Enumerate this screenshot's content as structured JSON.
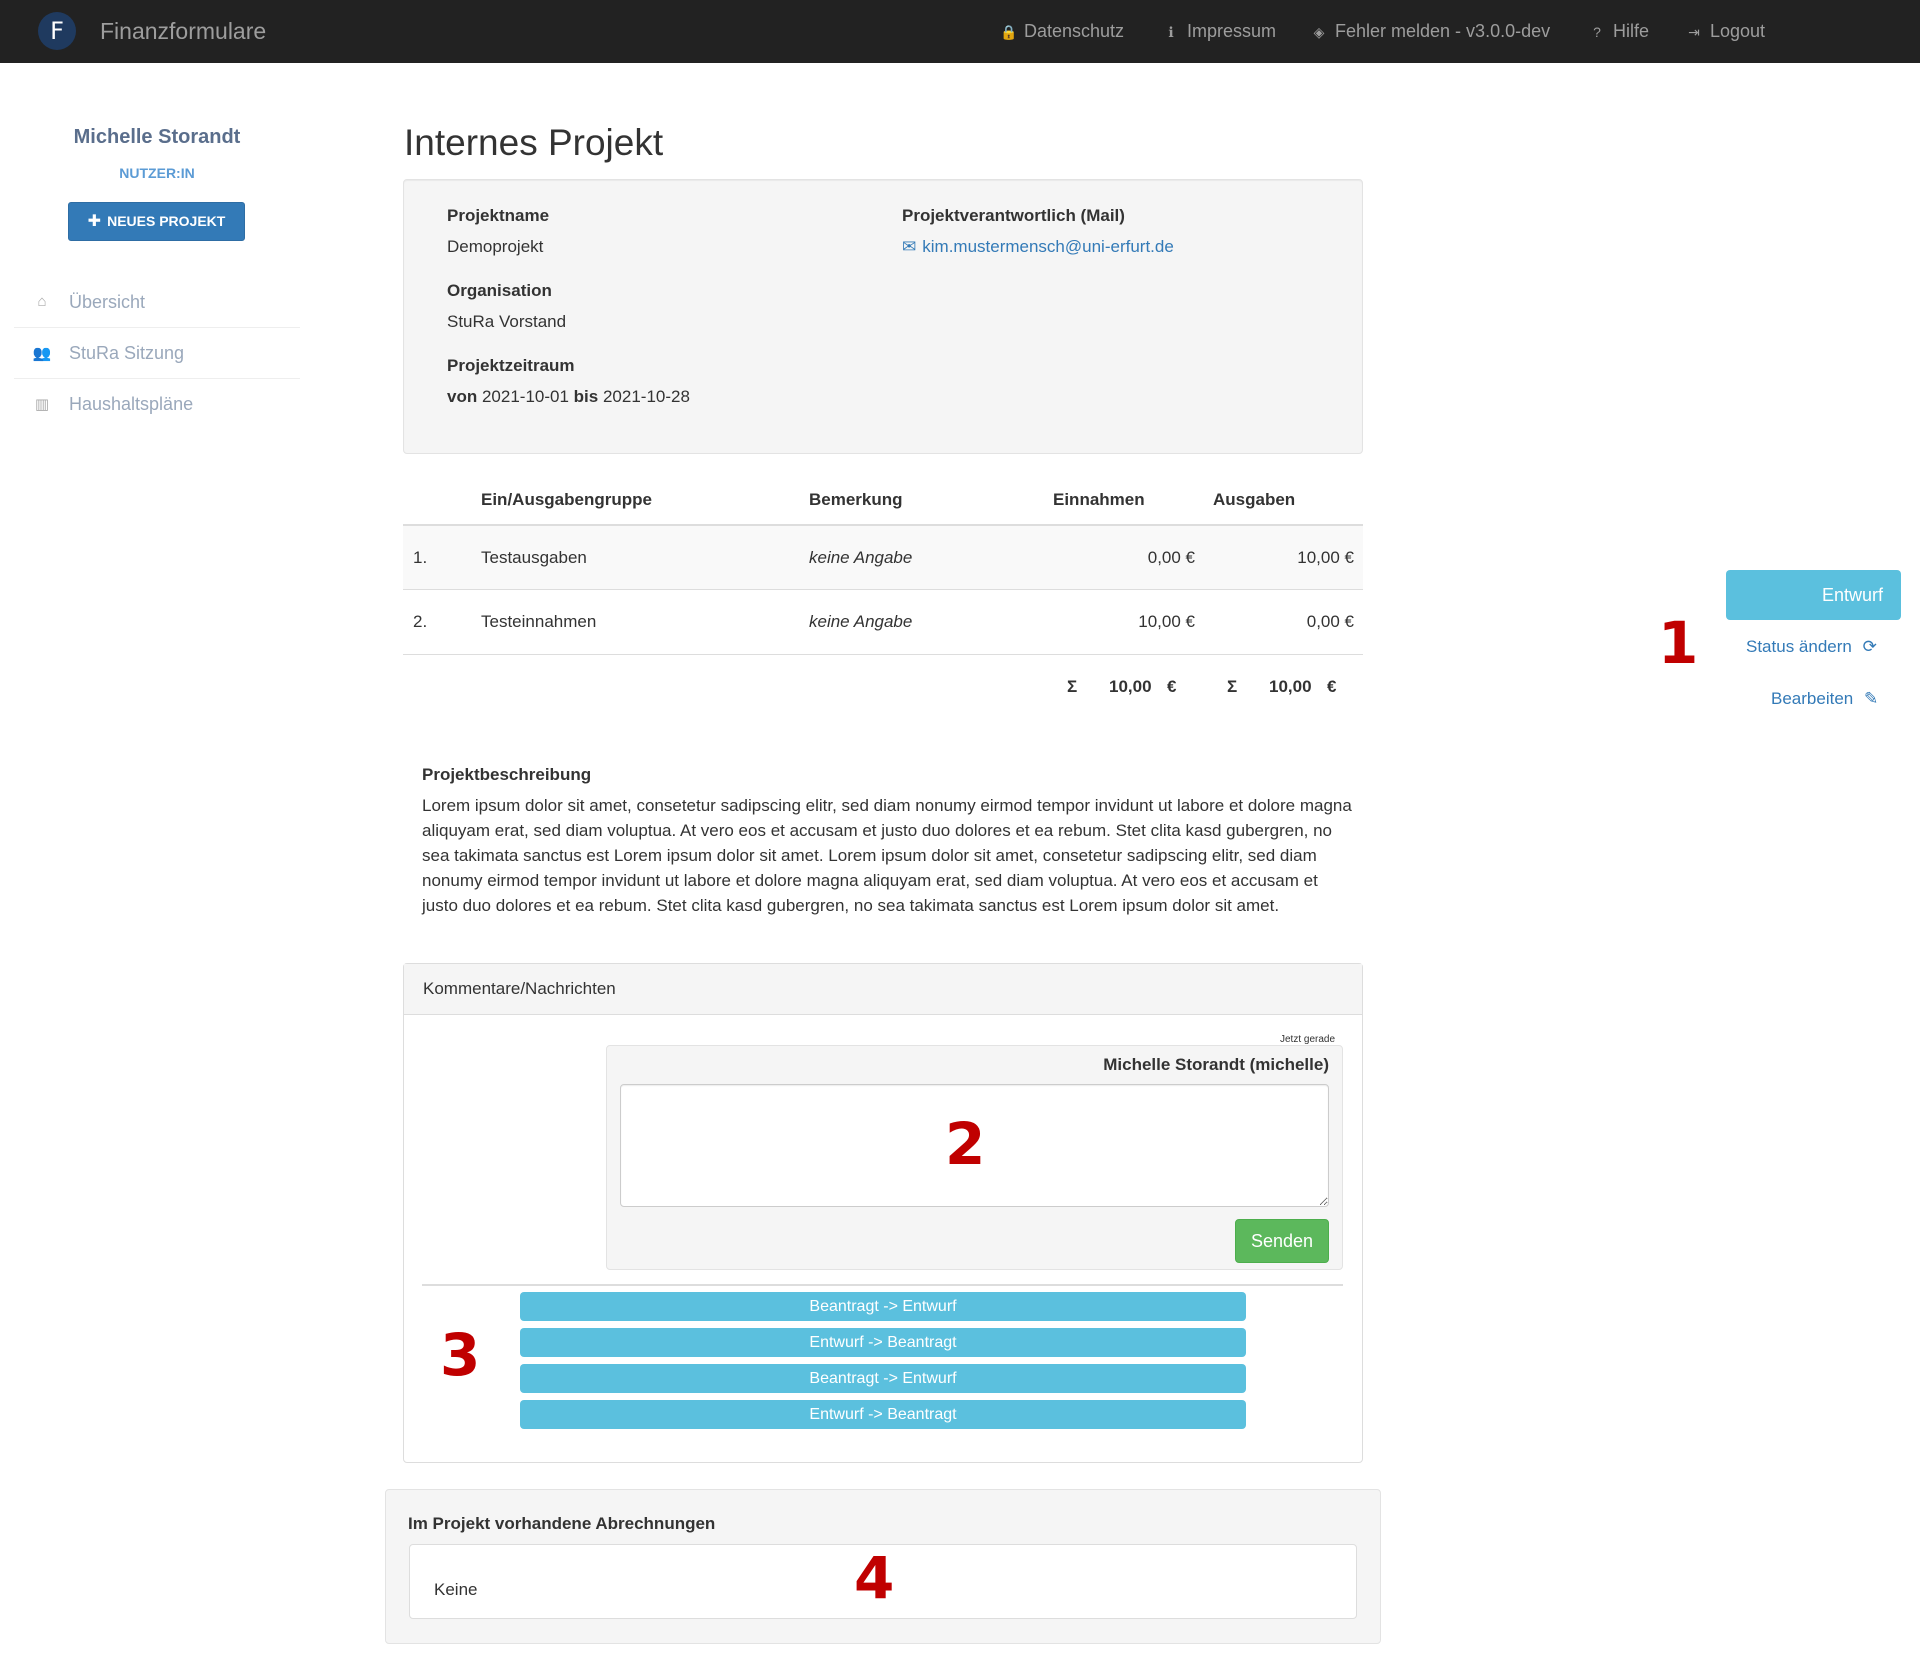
{
  "navbar": {
    "logo_letter": "F",
    "brand": "Finanzformulare",
    "items": [
      {
        "label": "Datenschutz",
        "icon": "lock-icon",
        "glyph": "🔒"
      },
      {
        "label": "Impressum",
        "icon": "info-icon",
        "glyph": "ℹ"
      },
      {
        "label": "Fehler melden - v3.0.0-dev",
        "icon": "gitlab-icon",
        "glyph": "◈"
      },
      {
        "label": "Hilfe",
        "icon": "question-icon",
        "glyph": "?"
      },
      {
        "label": "Logout",
        "icon": "logout-icon",
        "glyph": "⇥"
      }
    ]
  },
  "sidebar": {
    "user_name": "Michelle Storandt",
    "user_role": "NUTZER:IN",
    "new_project_label": "NEUES PROJEKT",
    "items": [
      {
        "label": "Übersicht",
        "icon": "home-icon",
        "glyph": "⌂"
      },
      {
        "label": "StuRa Sitzung",
        "icon": "users-icon",
        "glyph": "👥"
      },
      {
        "label": "Haushaltspläne",
        "icon": "bar-chart-icon",
        "glyph": "▥"
      }
    ]
  },
  "project": {
    "page_title": "Internes Projekt",
    "name_label": "Projektname",
    "name": "Demoprojekt",
    "owner_label": "Projektverantwortlich (Mail)",
    "owner_mail": "kim.mustermensch@uni-erfurt.de",
    "org_label": "Organisation",
    "org": "StuRa Vorstand",
    "period_label": "Projektzeitraum",
    "period_from_word": "von",
    "period_from": "2021-10-01",
    "period_to_word": "bis",
    "period_to": "2021-10-28"
  },
  "table": {
    "headers": [
      "Ein/Ausgabengruppe",
      "Bemerkung",
      "Einnahmen",
      "Ausgaben"
    ],
    "rows": [
      {
        "num": "1.",
        "group": "Testausgaben",
        "remark": "keine Angabe",
        "income": "0,00 €",
        "expense": "10,00 €"
      },
      {
        "num": "2.",
        "group": "Testeinnahmen",
        "remark": "keine Angabe",
        "income": "10,00 €",
        "expense": "0,00 €"
      }
    ],
    "sum_symbol": "Σ",
    "sum_income": "10,00",
    "sum_expense": "10,00",
    "currency": "€"
  },
  "status": {
    "current": "Entwurf",
    "change_label": "Status ändern",
    "edit_label": "Bearbeiten"
  },
  "description": {
    "title": "Projektbeschreibung",
    "text": "Lorem ipsum dolor sit amet, consetetur sadipscing elitr, sed diam nonumy eirmod tempor invidunt ut labore et dolore magna aliquyam erat, sed diam voluptua. At vero eos et accusam et justo duo dolores et ea rebum. Stet clita kasd gubergren, no sea takimata sanctus est Lorem ipsum dolor sit amet. Lorem ipsum dolor sit amet, consetetur sadipscing elitr, sed diam nonumy eirmod tempor invidunt ut labore et dolore magna aliquyam erat, sed diam voluptua. At vero eos et accusam et justo duo dolores et ea rebum. Stet clita kasd gubergren, no sea takimata sanctus est Lorem ipsum dolor sit amet."
  },
  "comments": {
    "panel_title": "Kommentare/Nachrichten",
    "timestamp": "Jetzt gerade",
    "author": "Michelle Storandt (michelle)",
    "input_value": "",
    "send_label": "Senden",
    "history": [
      "Beantragt -> Entwurf",
      "Entwurf -> Beantragt",
      "Beantragt -> Entwurf",
      "Entwurf -> Beantragt"
    ]
  },
  "billing": {
    "title": "Im Projekt vorhandene Abrechnungen",
    "value": "Keine"
  },
  "annotations": [
    "1",
    "2",
    "3",
    "4"
  ],
  "colors": {
    "navbar_bg": "#222222",
    "primary": "#337ab7",
    "info": "#5bc0de",
    "success": "#5cb85c",
    "annotation_red": "#c00000"
  }
}
